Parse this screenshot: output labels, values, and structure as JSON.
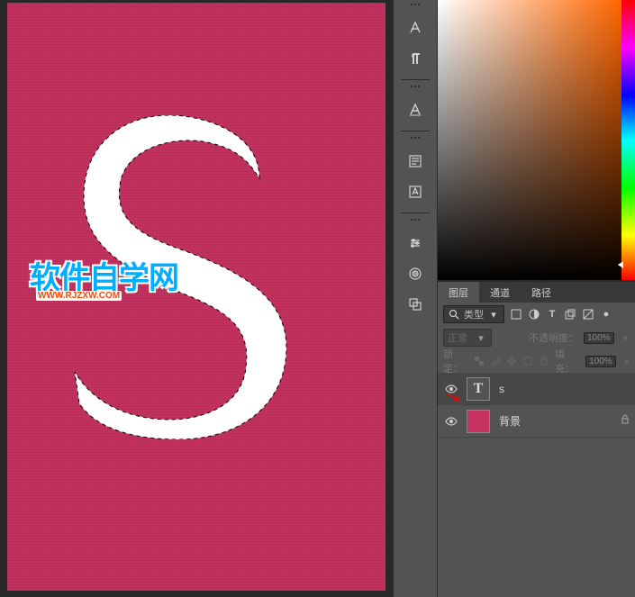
{
  "canvas": {
    "letter": "S",
    "watermark_main": "软件自学网",
    "watermark_sub": "WWW.RJZXW.COM"
  },
  "toolStrip": {
    "icons": [
      "character-icon",
      "paragraph-icon",
      "glyph-icon",
      "paragraph-styles-icon",
      "character-styles-icon"
    ],
    "icons2": [
      "adjust-icon",
      "styles-icon",
      "layers-icon"
    ]
  },
  "layersPanel": {
    "tabs": {
      "layers": "图层",
      "channels": "通道",
      "paths": "路径"
    },
    "filterLabel": "类型",
    "blend": {
      "mode": "正常",
      "opacityLabel": "不透明度：",
      "opacityVal": "100%"
    },
    "lockRow": {
      "label": "锁定：",
      "fillLabel": "填充：",
      "fillVal": "100%"
    },
    "layers": [
      {
        "name": "s",
        "type": "text"
      },
      {
        "name": "背景",
        "type": "bg"
      }
    ]
  }
}
